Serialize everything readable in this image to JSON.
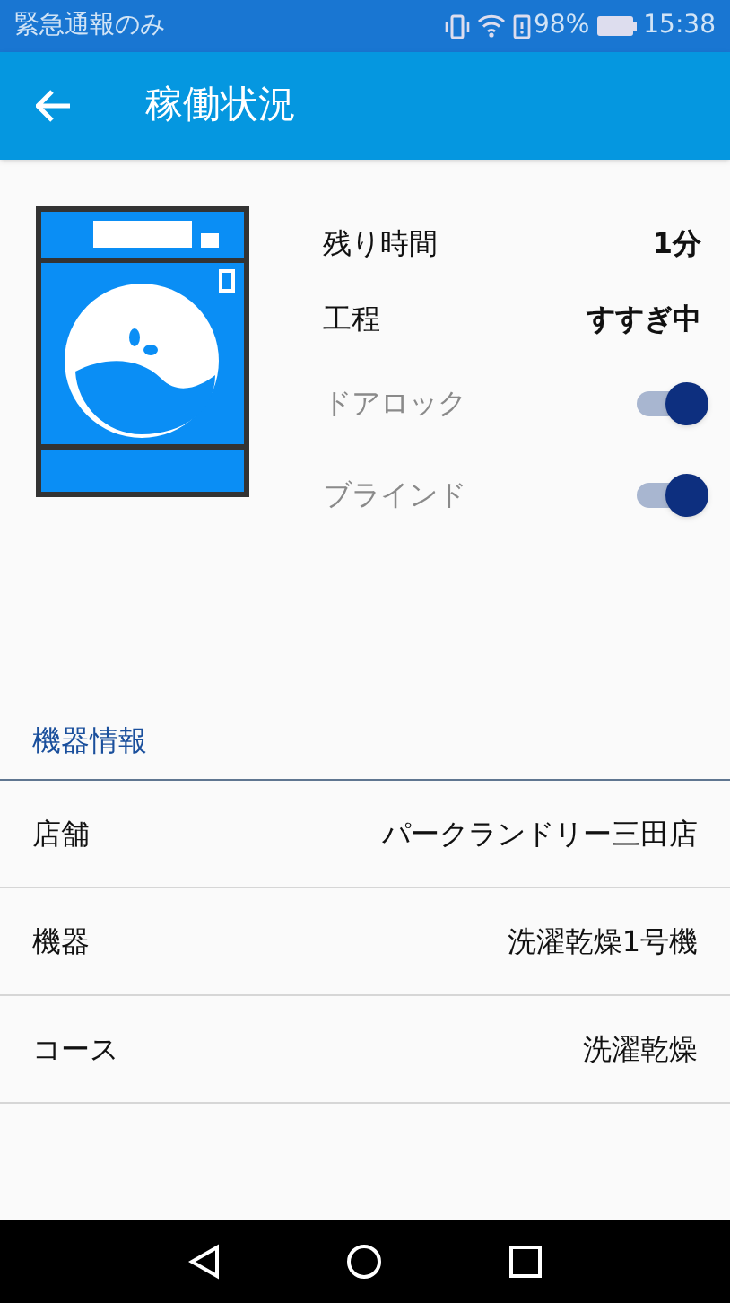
{
  "status_bar": {
    "carrier": "緊急通報のみ",
    "battery_percent": "98%",
    "time": "15:38"
  },
  "app_bar": {
    "title": "稼働状況"
  },
  "status": [
    {
      "kind": "text",
      "label": "残り時間",
      "value": "1分"
    },
    {
      "kind": "text",
      "label": "工程",
      "value": "すすぎ中"
    },
    {
      "kind": "toggle",
      "label": "ドアロック",
      "on": true,
      "disabled": true
    },
    {
      "kind": "toggle",
      "label": "ブラインド",
      "on": true,
      "disabled": true
    }
  ],
  "section": {
    "title": "機器情報"
  },
  "info_rows": [
    {
      "label": "店舗",
      "value": "パークランドリー三田店"
    },
    {
      "label": "機器",
      "value": "洗濯乾燥1号機"
    },
    {
      "label": "コース",
      "value": "洗濯乾燥"
    }
  ]
}
